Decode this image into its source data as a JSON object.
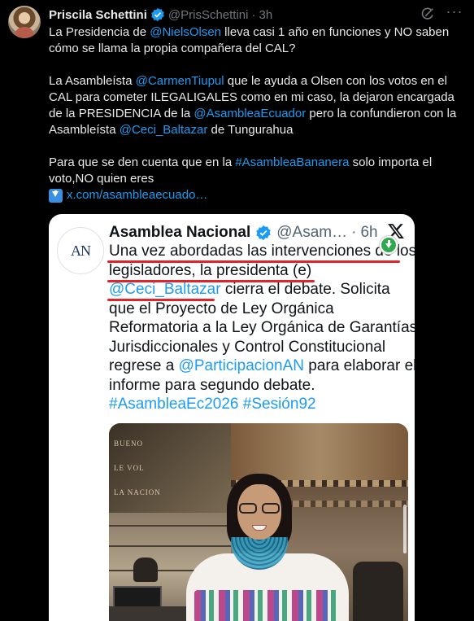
{
  "tweet": {
    "display_name": "Priscila Schettini",
    "handle": "@PrisSchettini",
    "separator": "·",
    "time": "3h",
    "paragraphs": [
      [
        {
          "t": "La Presidencia de ",
          "k": "text"
        },
        {
          "t": "@NielsOlsen",
          "k": "mention"
        },
        {
          "t": " lleva casi 1 año en funciones y NO saben cómo se llama la propia compañera del CAL?",
          "k": "text"
        }
      ],
      [
        {
          "t": "La Asambleísta ",
          "k": "text"
        },
        {
          "t": "@CarmenTiupul",
          "k": "mention"
        },
        {
          "t": " que le ayuda a Olsen con los votos en el CAL para cometer ILEGALIGALES como en mi caso, la dejaron encargada de la PRESIDENCIA de la ",
          "k": "text"
        },
        {
          "t": "@AsambleaEcuador",
          "k": "mention"
        },
        {
          "t": " pero la confundieron con la Asambleísta ",
          "k": "text"
        },
        {
          "t": "@Ceci_Baltazar",
          "k": "mention"
        },
        {
          "t": " de Tungurahua",
          "k": "text"
        }
      ],
      [
        {
          "t": "Para que se den cuenta que en la ",
          "k": "text"
        },
        {
          "t": "#AsambleaBananera",
          "k": "hashtag"
        },
        {
          "t": " solo importa el voto,NO quien eres",
          "k": "text"
        }
      ]
    ],
    "link_text": "x.com/asambleaecuado…"
  },
  "quote": {
    "avatar_text": "AN",
    "display_name": "Asamblea Nacional",
    "handle": "@Asam…",
    "separator": "·",
    "time": "6h",
    "lines": [
      [
        {
          "t": "Una vez abordadas las intervenciones de los",
          "k": "text"
        }
      ],
      [
        {
          "t": "legisladores, la presidenta (e)",
          "k": "text"
        }
      ],
      [
        {
          "t": "@Ceci_Baltazar",
          "k": "mention"
        },
        {
          "t": " cierra el debate. Solicita",
          "k": "text"
        }
      ],
      [
        {
          "t": "que el Proyecto de Ley Orgánica",
          "k": "text"
        }
      ],
      [
        {
          "t": "Reformatoria a la Ley Orgánica de Garantías",
          "k": "text"
        }
      ],
      [
        {
          "t": "Jurisdiccionales y Control Constitucional",
          "k": "text"
        }
      ],
      [
        {
          "t": "regrese a ",
          "k": "text"
        },
        {
          "t": "@ParticipacionAN",
          "k": "mention"
        },
        {
          "t": " para elaborar el",
          "k": "text"
        }
      ],
      [
        {
          "t": "informe para segundo debate.",
          "k": "text"
        }
      ],
      [
        {
          "t": "#AsambleaEc2026",
          "k": "mention"
        },
        {
          "t": " ",
          "k": "text"
        },
        {
          "t": "#Sesión92",
          "k": "mention"
        }
      ]
    ],
    "wall_text": [
      "BUENO",
      "LE VOL",
      "LA NACION"
    ]
  },
  "colors": {
    "link_blue": "#1d9bf0",
    "underline_red": "#e0242a",
    "background": "#000000",
    "verified_blue": "#1d9bf0"
  },
  "icons": [
    "verified-badge-icon",
    "grok-icon",
    "more-icon",
    "download-arrow-icon",
    "x-logo-icon",
    "green-download-icon"
  ]
}
